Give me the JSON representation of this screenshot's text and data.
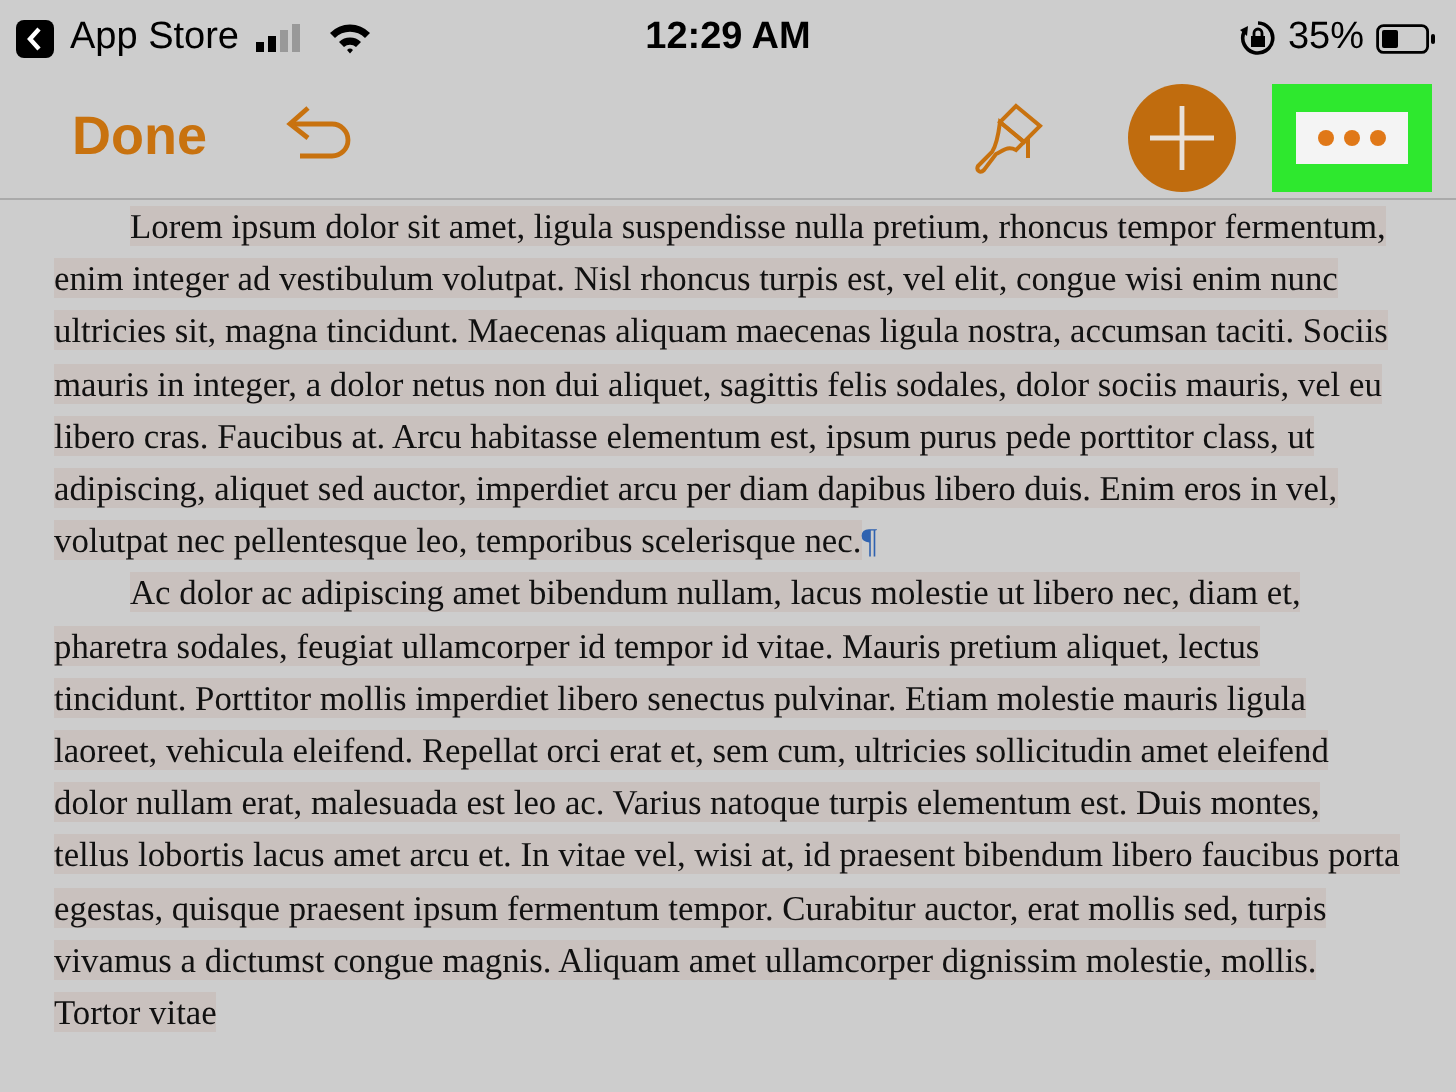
{
  "status_bar": {
    "back_label": "App Store",
    "time": "12:29 AM",
    "battery_percent": "35%"
  },
  "toolbar": {
    "done_label": "Done",
    "more_button": {
      "highlighted": true
    }
  },
  "document": {
    "selected": true,
    "paragraphs": [
      {
        "text": "Lorem ipsum dolor sit amet, ligula suspendisse nulla pretium, rhoncus tempor fermentum, enim integer ad vestibulum volutpat. Nisl rhoncus turpis est, vel elit, congue wisi enim nunc ultricies sit, magna tincidunt. Maecenas aliquam maecenas ligula nostra, accumsan taciti. Sociis mauris in integer, a dolor netus non dui aliquet, sagittis felis sodales, dolor sociis mauris, vel eu libero cras. Faucibus at. Arcu habitasse elementum est, ipsum purus pede porttitor class, ut adipiscing, aliquet sed auctor, imperdiet arcu per diam dapibus libero duis. Enim eros in vel, volutpat nec pellentesque leo, temporibus scelerisque nec.",
        "pilcrow": "¶"
      },
      {
        "text": "Ac dolor ac adipiscing amet bibendum nullam, lacus molestie ut libero nec, diam et, pharetra sodales, feugiat ullamcorper id tempor id vitae. Mauris pretium aliquet, lectus tincidunt. Porttitor mollis imperdiet libero senectus pulvinar. Etiam molestie mauris ligula laoreet, vehicula eleifend. Repellat orci erat et, sem cum, ultricies sollicitudin amet eleifend dolor nullam erat, malesuada est leo ac. Varius natoque turpis elementum est. Duis montes, tellus lobortis lacus amet arcu et. In vitae vel, wisi at, id praesent bibendum libero faucibus porta egestas, quisque praesent ipsum fermentum tempor. Curabitur auctor, erat mollis sed, turpis vivamus a dictumst congue magnis. Aliquam amet ullamcorper dignissim molestie, mollis. Tortor vitae"
      }
    ]
  }
}
